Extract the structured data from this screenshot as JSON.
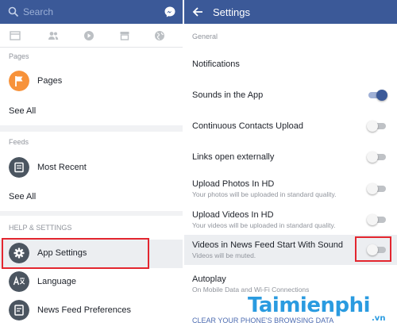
{
  "left": {
    "search": {
      "placeholder": "Search",
      "icon": "search-icon"
    },
    "messenger_icon": "messenger-icon",
    "tabs": [
      "news-feed-icon",
      "friends-icon",
      "video-icon",
      "marketplace-icon",
      "globe-icon"
    ],
    "pages_section": {
      "header": "Pages",
      "item": "Pages",
      "icon": "flag-icon",
      "icon_color": "#f7923a",
      "see_all": "See All"
    },
    "feeds_section": {
      "header": "Feeds",
      "item": "Most Recent",
      "icon": "feed-icon",
      "icon_color": "#4b5560",
      "see_all": "See All"
    },
    "help_section": {
      "header": "HELP & SETTINGS",
      "items": [
        {
          "label": "App Settings",
          "icon": "gear-icon",
          "highlighted": true
        },
        {
          "label": "Language",
          "icon": "language-icon"
        },
        {
          "label": "News Feed Preferences",
          "icon": "news-feed-preferences-icon"
        }
      ]
    }
  },
  "right": {
    "title": "Settings",
    "section": "General",
    "settings": [
      {
        "title": "Notifications",
        "subtitle": "",
        "toggle": null
      },
      {
        "title": "Sounds in the App",
        "subtitle": "",
        "toggle": true
      },
      {
        "title": "Continuous Contacts Upload",
        "subtitle": "",
        "toggle": false
      },
      {
        "title": "Links open externally",
        "subtitle": "",
        "toggle": false
      },
      {
        "title": "Upload Photos In HD",
        "subtitle": "Your photos will be uploaded in standard quality.",
        "toggle": false
      },
      {
        "title": "Upload Videos In HD",
        "subtitle": "Your videos will be uploaded in standard quality.",
        "toggle": false
      },
      {
        "title": "Videos in News Feed Start With Sound",
        "subtitle": "Videos will be muted.",
        "toggle": false,
        "highlighted": true
      },
      {
        "title": "Autoplay",
        "subtitle": "On Mobile Data and Wi-Fi Connections",
        "toggle": null
      }
    ],
    "clear_link": "CLEAR YOUR PHONE'S BROWSING DATA"
  },
  "watermark": {
    "main": "Taimienphi",
    "suffix": ".vn"
  },
  "colors": {
    "brand": "#3b5998",
    "highlight_box": "#e3262f",
    "toggle_on": "#3b5998",
    "toggle_off": "#bfc2c6"
  }
}
